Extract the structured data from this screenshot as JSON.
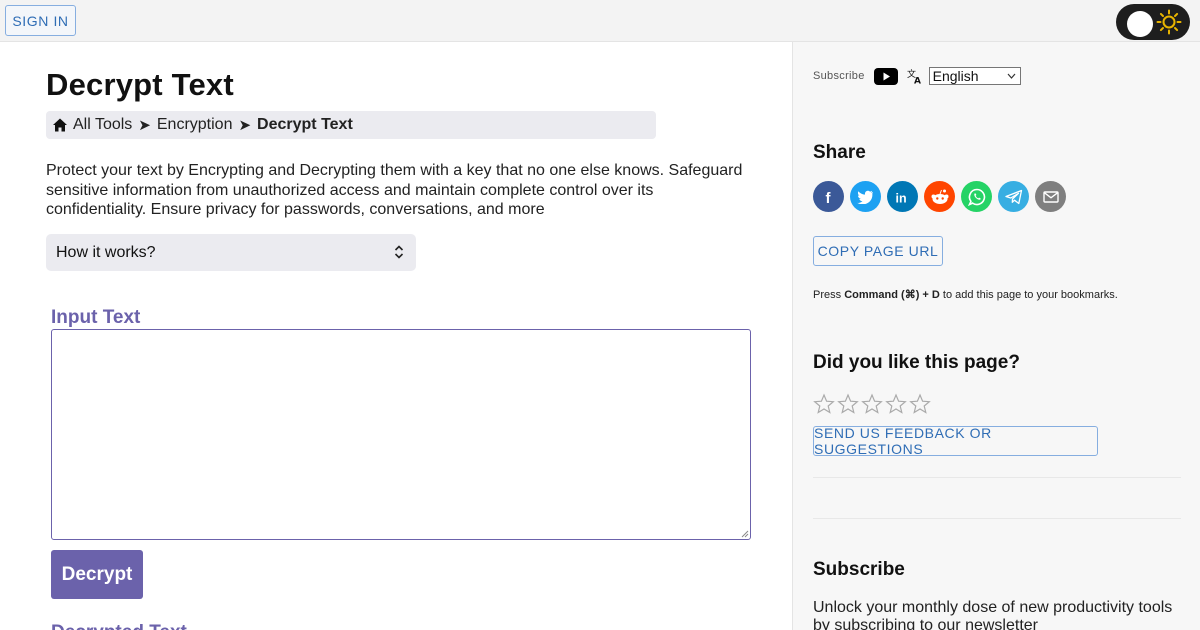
{
  "topbar": {
    "signin_label": "SIGN IN"
  },
  "main": {
    "title": "Decrypt Text",
    "breadcrumb": {
      "items": [
        "All Tools",
        "Encryption"
      ],
      "separator": "➤",
      "current": "Decrypt Text"
    },
    "intro": "Protect your text by Encrypting and Decrypting them with a key that no one else knows. Safeguard sensitive information from unauthorized access and maintain complete control over its confidentiality. Ensure privacy for passwords, conversations, and more",
    "how_it_works_label": "How it works?",
    "input_label": "Input Text",
    "input_value": "",
    "decrypt_button_label": "Decrypt",
    "output_label": "Decrypted Text"
  },
  "sidebar": {
    "subscribe_label": "Subscribe",
    "language": {
      "selected": "English"
    },
    "share_title": "Share",
    "share_icons": [
      "facebook-icon",
      "twitter-icon",
      "linkedin-icon",
      "reddit-icon",
      "whatsapp-icon",
      "telegram-icon",
      "email-icon"
    ],
    "copy_url_label": "COPY PAGE URL",
    "bookmark_tip": {
      "prefix": "Press",
      "shortcut": "Command (⌘) + D",
      "suffix": "to add this page to your bookmarks."
    },
    "like_title": "Did you like this page?",
    "rating": {
      "value": 0,
      "max": 5
    },
    "feedback_label": "SEND US FEEDBACK OR SUGGESTIONS",
    "subscribe_title": "Subscribe",
    "subscribe_text": "Unlock your monthly dose of new productivity tools by subscribing to our newsletter"
  },
  "colors": {
    "accent": "#6b62ab",
    "link": "#2f6db5",
    "facebook": "#3b5998",
    "twitter": "#1da1f2",
    "linkedin": "#0077b5",
    "reddit": "#ff4500",
    "whatsapp": "#25d366",
    "telegram": "#37aee2",
    "email": "#7f7f7f"
  }
}
